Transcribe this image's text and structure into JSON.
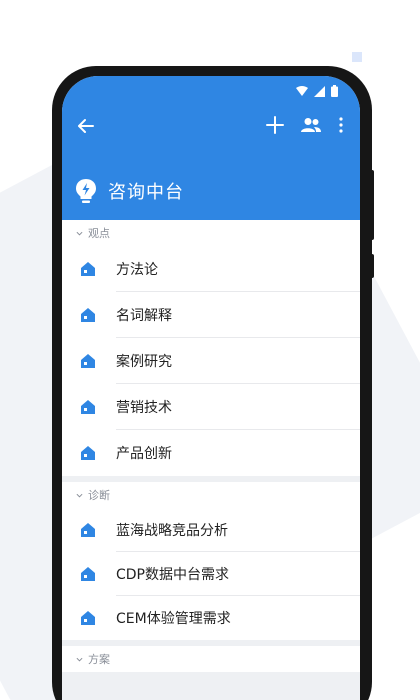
{
  "app": {
    "title": "咨询中台"
  },
  "colors": {
    "primary": "#2f86e3",
    "item_icon": "#2f86e3",
    "section_text": "#8a8f99"
  },
  "icons": {
    "back": "arrow-left-icon",
    "add": "plus-icon",
    "members": "people-icon",
    "more": "more-vertical-icon",
    "logo": "lightbulb-icon",
    "item": "house-icon"
  },
  "sections": [
    {
      "label": "观点",
      "items": [
        "方法论",
        "名词解释",
        "案例研究",
        "营销技术",
        "产品创新"
      ]
    },
    {
      "label": "诊断",
      "items": [
        "蓝海战略竞品分析",
        "CDP数据中台需求",
        "CEM体验管理需求"
      ]
    },
    {
      "label": "方案",
      "items": []
    }
  ]
}
